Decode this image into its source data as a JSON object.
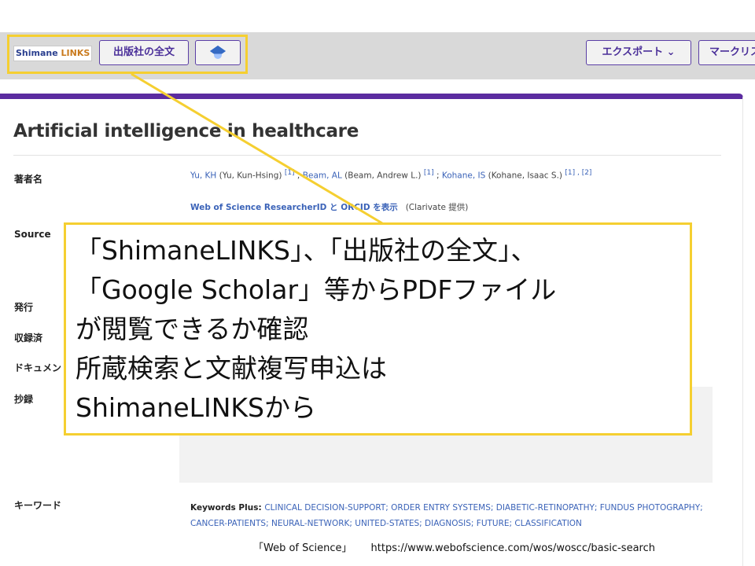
{
  "toolbar": {
    "logo_part1": "Shimane",
    "logo_part2": "LINKS",
    "fulltext_label": "出版社の全文",
    "google_scholar_icon": "google-scholar-icon",
    "export_label": "エクスポート ⌄",
    "mark_label": "マークリスト"
  },
  "record": {
    "title": "Artificial intelligence in healthcare",
    "fields": {
      "authors_label": "著者名",
      "source_label": "Source",
      "published_label": "発行",
      "indexed_label": "収録済",
      "doctype_label": "ドキュメントタイプ",
      "abstract_label": "抄録",
      "keywords_label": "キーワード"
    },
    "authors": [
      {
        "name": "Yu, KH",
        "full": " (Yu, Kun-Hsing) ",
        "aff": "[1]",
        "sep": " ; "
      },
      {
        "name": "Beam, AL",
        "full": " (Beam, Andrew L.) ",
        "aff": "[1]",
        "sep": " ; "
      },
      {
        "name": "Kohane, IS",
        "full": " (Kohane, Isaac S.) ",
        "aff": "[1] , [2]",
        "sep": ""
      }
    ],
    "researcher_link": "Web of Science ResearcherID と ORCID を表示",
    "researcher_provider": "(Clarivate 提供)",
    "keywords_plus_label": "Keywords Plus: ",
    "keywords_plus": "CLINICAL DECISION-SUPPORT; ORDER ENTRY SYSTEMS; DIABETIC-RETINOPATHY; FUNDUS PHOTOGRAPHY; CANCER-PATIENTS; NEURAL-NETWORK; UNITED-STATES; DIAGNOSIS; FUTURE; CLASSIFICATION"
  },
  "callout": {
    "lines": [
      "「ShimaneLINKS」、「出版社の全文」、",
      "「Google Scholar」等からPDFファイル",
      "が閲覧できるか確認",
      "所蔵検索と文献複写申込は",
      "ShimaneLINKSから"
    ]
  },
  "footer": {
    "source_name": "「Web of Science」",
    "source_url": "https://www.webofscience.com/wos/woscc/basic-search"
  },
  "colors": {
    "highlight": "#f5cf31",
    "accent": "#5b2ca0",
    "link": "#3b63b8"
  }
}
